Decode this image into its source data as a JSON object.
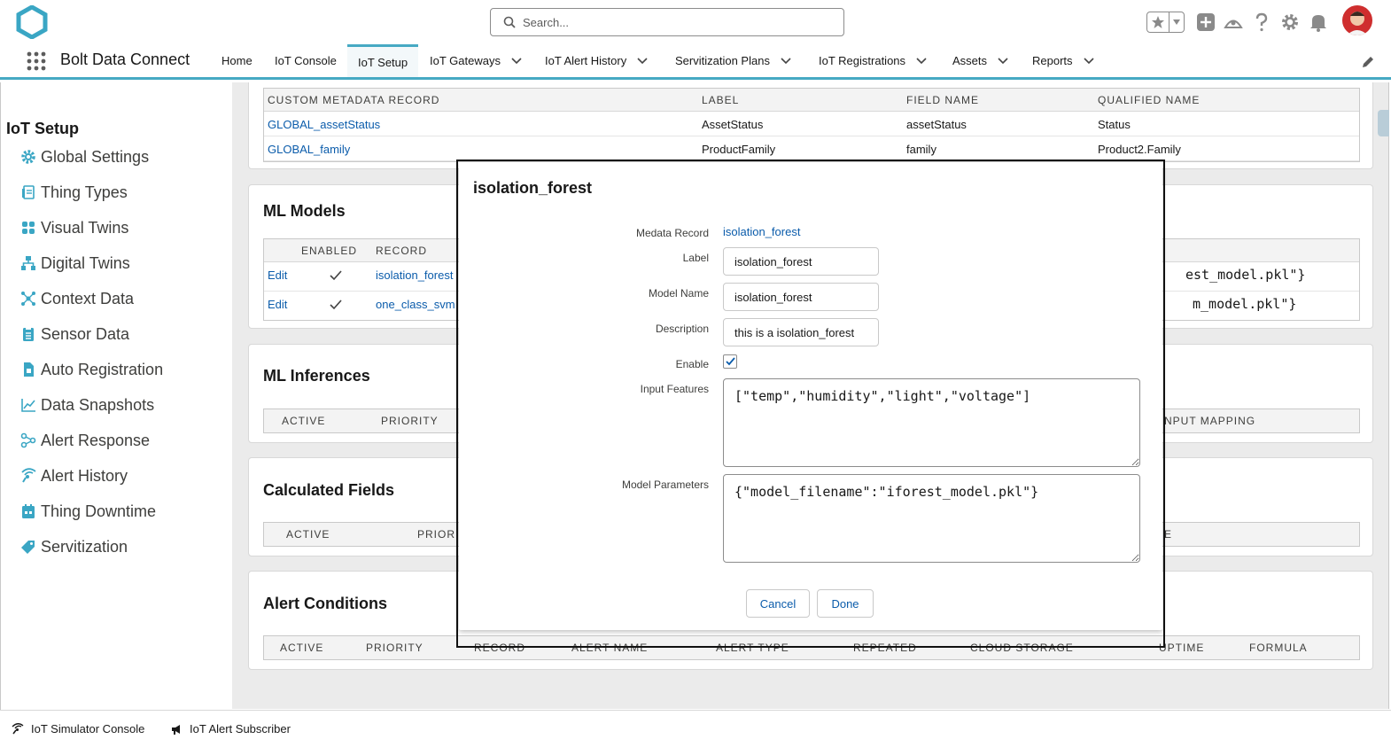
{
  "header": {
    "search_placeholder": "Search...",
    "colors": {
      "accent": "#46a9c3",
      "link": "#0b5cab",
      "logo": "#3aa6c4"
    }
  },
  "app_nav": {
    "app_name": "Bolt Data Connect",
    "tabs": [
      {
        "label": "Home",
        "has_menu": false,
        "active": false
      },
      {
        "label": "IoT Console",
        "has_menu": false,
        "active": false
      },
      {
        "label": "IoT Setup",
        "has_menu": false,
        "active": true
      },
      {
        "label": "IoT Gateways",
        "has_menu": true,
        "active": false
      },
      {
        "label": "IoT Alert History",
        "has_menu": true,
        "active": false
      },
      {
        "label": "Servitization Plans",
        "has_menu": true,
        "active": false
      },
      {
        "label": "IoT Registrations",
        "has_menu": true,
        "active": false
      },
      {
        "label": "Assets",
        "has_menu": true,
        "active": false
      },
      {
        "label": "Reports",
        "has_menu": true,
        "active": false
      }
    ]
  },
  "sidebar": {
    "title": "IoT Setup",
    "items": [
      {
        "label": "Global Settings",
        "icon": "gear-icon"
      },
      {
        "label": "Thing Types",
        "icon": "document-icon"
      },
      {
        "label": "Visual Twins",
        "icon": "grid-icon"
      },
      {
        "label": "Digital Twins",
        "icon": "hierarchy-icon"
      },
      {
        "label": "Context Data",
        "icon": "network-icon"
      },
      {
        "label": "Sensor Data",
        "icon": "list-icon"
      },
      {
        "label": "Auto Registration",
        "icon": "file-icon"
      },
      {
        "label": "Data Snapshots",
        "icon": "line-chart-icon"
      },
      {
        "label": "Alert Response",
        "icon": "flow-icon"
      },
      {
        "label": "Alert History",
        "icon": "signal-icon"
      },
      {
        "label": "Thing Downtime",
        "icon": "calendar-icon"
      },
      {
        "label": "Servitization",
        "icon": "tag-icon"
      }
    ]
  },
  "content": {
    "metadata_table": {
      "headers": [
        "CUSTOM METADATA RECORD",
        "LABEL",
        "FIELD NAME",
        "QUALIFIED NAME"
      ],
      "rows": [
        [
          "GLOBAL_assetStatus",
          "AssetStatus",
          "assetStatus",
          "Status"
        ],
        [
          "GLOBAL_family",
          "ProductFamily",
          "family",
          "Product2.Family"
        ]
      ]
    },
    "ml_models": {
      "title": "ML Models",
      "headers": [
        "ENABLED",
        "RECORD"
      ],
      "rows": [
        {
          "action": "Edit",
          "record": "isolation_forest",
          "params_tail": "est_model.pkl\"}"
        },
        {
          "action": "Edit",
          "record": "one_class_svm",
          "params_tail": "m_model.pkl\"}"
        }
      ]
    },
    "ml_inferences": {
      "title": "ML Inferences",
      "headers": [
        "ACTIVE",
        "PRIORITY",
        "NPUT MAPPING"
      ]
    },
    "calculated_fields": {
      "title": "Calculated Fields",
      "headers": [
        "ACTIVE",
        "PRIORI",
        "E"
      ]
    },
    "alert_conditions": {
      "title": "Alert Conditions",
      "headers": [
        "ACTIVE",
        "PRIORITY",
        "RECORD",
        "ALERT NAME",
        "ALERT TYPE",
        "REPEATED",
        "CLOUD STORAGE",
        "UPTIME",
        "FORMULA"
      ]
    }
  },
  "modal": {
    "title": "isolation_forest",
    "fields": {
      "record_label": "Medata Record",
      "record_value": "isolation_forest",
      "label_label": "Label",
      "label_value": "isolation_forest",
      "model_name_label": "Model Name",
      "model_name_value": "isolation_forest",
      "description_label": "Description",
      "description_value": "this is a isolation_forest",
      "enable_label": "Enable",
      "enable_checked": true,
      "input_features_label": "Input Features",
      "input_features_value": "[\"temp\",\"humidity\",\"light\",\"voltage\"]",
      "model_params_label": "Model Parameters",
      "model_params_value": "{\"model_filename\":\"iforest_model.pkl\"}"
    },
    "cancel_label": "Cancel",
    "done_label": "Done"
  },
  "utility_bar": {
    "items": [
      {
        "label": "IoT Simulator Console",
        "icon": "broadcast-icon"
      },
      {
        "label": "IoT Alert Subscriber",
        "icon": "megaphone-icon"
      }
    ]
  }
}
